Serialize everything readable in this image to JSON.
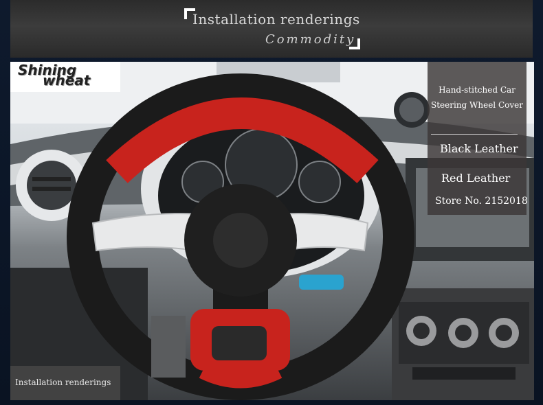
{
  "header": {
    "title": "Installation renderings",
    "subtitle": "Commodity"
  },
  "logo": {
    "line1": "Shining",
    "line2": "wheat"
  },
  "panel": {
    "title": "Hand-stitched Car Steering Wheel Cover",
    "option_black": "Black Leather",
    "option_red": "Red Leather",
    "store": "Store No. 2152018"
  },
  "badge": {
    "label": "Installation renderings"
  },
  "colors": {
    "wheel_red": "#c8231d",
    "wheel_black": "#1b1b1b",
    "header_bg": "#333333",
    "page_bg": "#0c1524"
  }
}
